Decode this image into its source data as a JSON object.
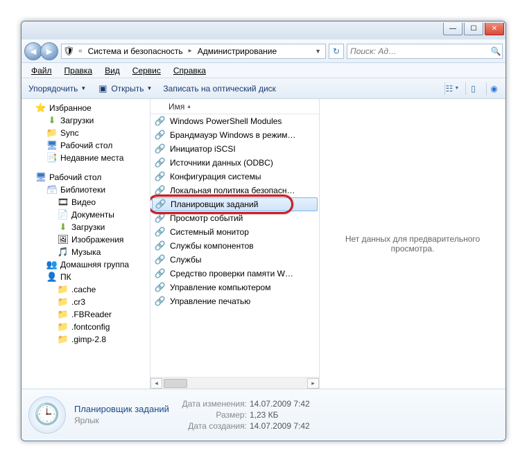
{
  "window_controls": {
    "min": "—",
    "max": "☐",
    "close": "✕"
  },
  "breadcrumbs": {
    "seg1": "Система и безопасность",
    "seg2": "Администрирование"
  },
  "search": {
    "placeholder": "Поиск: Ад…"
  },
  "menu": {
    "file": "Файл",
    "edit": "Правка",
    "view": "Вид",
    "tools": "Сервис",
    "help": "Справка"
  },
  "toolbar": {
    "organize": "Упорядочить",
    "open": "Открыть",
    "burn": "Записать на оптический диск"
  },
  "sidebar": {
    "favorites": "Избранное",
    "fav_items": [
      "Загрузки",
      "Sync",
      "Рабочий стол",
      "Недавние места"
    ],
    "desktop": "Рабочий стол",
    "libraries": "Библиотеки",
    "lib_items": [
      "Видео",
      "Документы",
      "Загрузки",
      "Изображения",
      "Музыка"
    ],
    "homegroup": "Домашняя группа",
    "pc": "ПК",
    "pc_items": [
      ".cache",
      ".cr3",
      ".FBReader",
      ".fontconfig",
      ".gimp-2.8"
    ]
  },
  "column": {
    "name": "Имя"
  },
  "files": [
    {
      "label": "Windows PowerShell Modules"
    },
    {
      "label": "Брандмауэр Windows в режим…"
    },
    {
      "label": "Инициатор iSCSI"
    },
    {
      "label": "Источники данных (ODBC)"
    },
    {
      "label": "Конфигурация системы"
    },
    {
      "label": "Локальная политика безопасн…"
    },
    {
      "label": "Планировщик заданий",
      "selected": true
    },
    {
      "label": "Просмотр событий"
    },
    {
      "label": "Системный монитор"
    },
    {
      "label": "Службы компонентов"
    },
    {
      "label": "Службы"
    },
    {
      "label": "Средство проверки памяти W…"
    },
    {
      "label": "Управление компьютером"
    },
    {
      "label": "Управление печатью"
    }
  ],
  "preview": {
    "empty": "Нет данных для предварительного просмотра."
  },
  "details": {
    "name": "Планировщик заданий",
    "type": "Ярлык",
    "modified_label": "Дата изменения:",
    "modified": "14.07.2009 7:42",
    "size_label": "Размер:",
    "size": "1,23 КБ",
    "created_label": "Дата создания:",
    "created": "14.07.2009 7:42"
  }
}
